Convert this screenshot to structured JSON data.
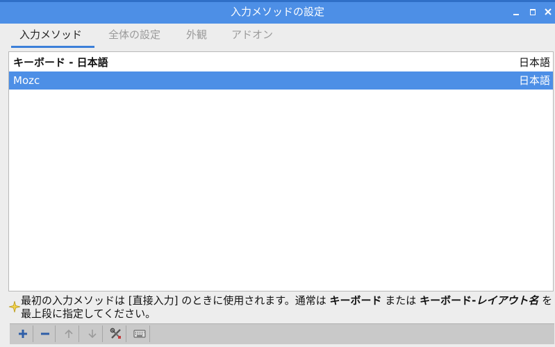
{
  "window": {
    "title": "入力メソッドの設定",
    "controls": [
      "minimize-icon",
      "maximize-icon",
      "close-icon"
    ]
  },
  "tabs": [
    {
      "label": "入力メソッド",
      "active": true
    },
    {
      "label": "全体の設定",
      "active": false
    },
    {
      "label": "外観",
      "active": false
    },
    {
      "label": "アドオン",
      "active": false
    }
  ],
  "list": {
    "rows": [
      {
        "name": "キーボード - 日本語",
        "language": "日本語",
        "selected": false
      },
      {
        "name": "Mozc",
        "language": "日本語",
        "selected": true
      }
    ]
  },
  "hint": {
    "icon": "sparkle-icon",
    "part1": "最初の入力メソッドは [直接入力] のときに使用されます。通常は ",
    "bold1": "キーボード",
    "part2": " または ",
    "bold2": "キーボード-",
    "bold2_italic": "レイアウト名",
    "part3": " を最上段に指定してください。"
  },
  "toolbar": {
    "buttons": [
      {
        "name": "add",
        "icon": "plus-icon",
        "enabled": true
      },
      {
        "name": "remove",
        "icon": "minus-icon",
        "enabled": true
      },
      {
        "name": "move-up",
        "icon": "arrow-up-icon",
        "enabled": false
      },
      {
        "name": "move-down",
        "icon": "arrow-down-icon",
        "enabled": false
      },
      {
        "name": "configure",
        "icon": "tools-icon",
        "enabled": true
      },
      {
        "name": "keyboard-layout",
        "icon": "keyboard-icon",
        "enabled": true
      }
    ]
  },
  "colors": {
    "titlebar": "#4d8fe6",
    "selection": "#4d8fe6",
    "accent": "#3b7fd9"
  }
}
